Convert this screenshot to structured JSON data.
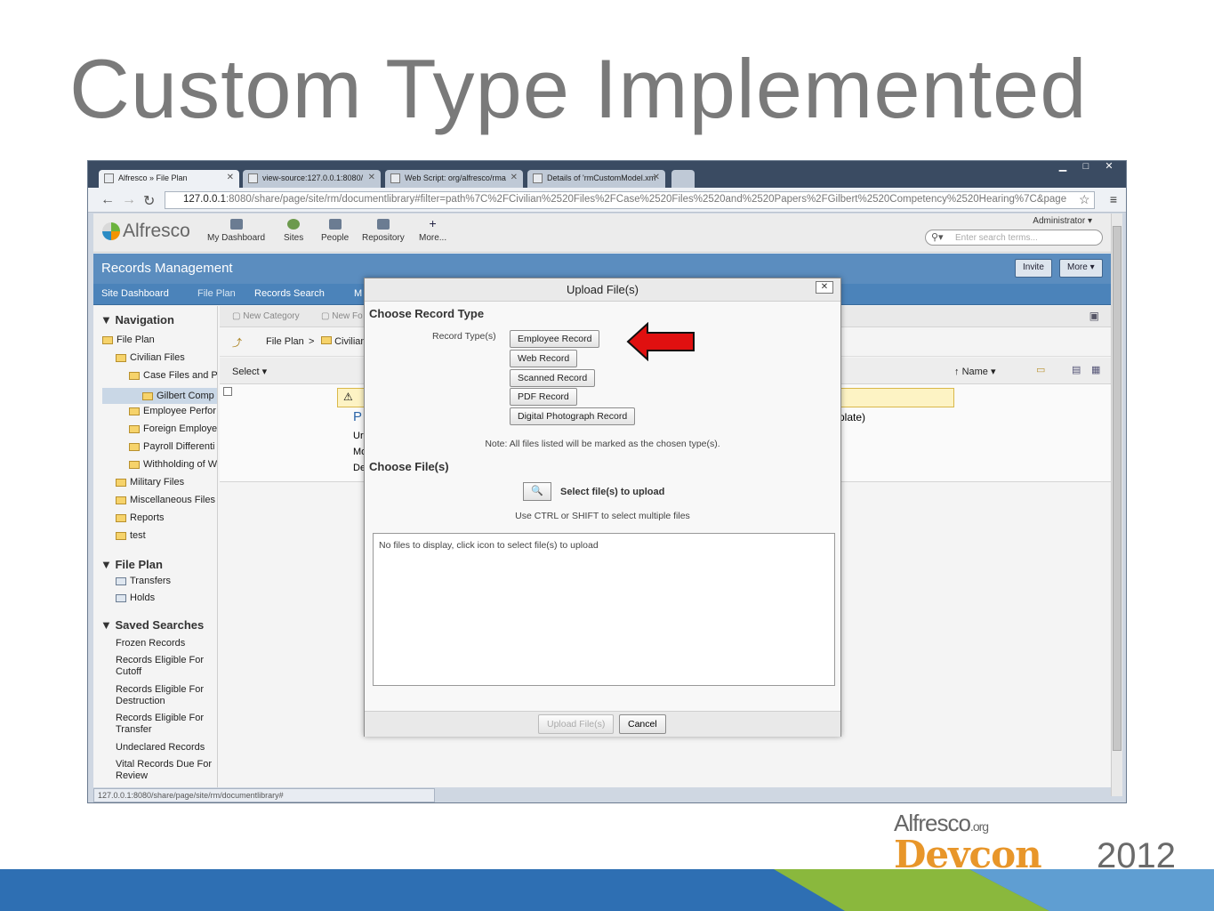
{
  "slide": {
    "title": "Custom Type Implemented",
    "logo_top": "Alfresco",
    "logo_top_suffix": "org",
    "logo_bottom": "Devcon",
    "logo_year": "2012",
    "band_color": "#2e6fb3",
    "band_accent_color": "#8ab83d"
  },
  "browser": {
    "tabs": [
      {
        "label": "Alfresco » File Plan",
        "active": true
      },
      {
        "label": "view-source:127.0.0.1:8080/",
        "active": false
      },
      {
        "label": "Web Script: org/alfresco/rma",
        "active": false
      },
      {
        "label": "Details of 'rmCustomModel.xm",
        "active": false
      }
    ],
    "address_host": "127.0.0.1",
    "address_rest": ":8080/share/page/site/rm/documentlibrary#filter=path%7C%2FCivilian%2520Files%2FCase%2520Files%2520and%2520Papers%2FGilbert%2520Competency%2520Hearing%7C&page",
    "status_url": "127.0.0.1:8080/share/page/site/rm/documentlibrary#"
  },
  "header": {
    "brand": "Alfresco",
    "nav": [
      "My Dashboard",
      "Sites",
      "People",
      "Repository",
      "More..."
    ],
    "user": "Administrator",
    "search_placeholder": "Enter search terms..."
  },
  "rm": {
    "title": "Records Management",
    "invite": "Invite",
    "more": "More",
    "subnav": [
      "Site Dashboard",
      "File Plan",
      "Records Search",
      "M"
    ]
  },
  "sidebar": {
    "navigation_heading": "Navigation",
    "tree": [
      {
        "label": "File Plan",
        "level": 0
      },
      {
        "label": "Civilian Files",
        "level": 1
      },
      {
        "label": "Case Files and P",
        "level": 2
      },
      {
        "label": "Gilbert Comp",
        "level": 3,
        "selected": true
      },
      {
        "label": "Employee Perfor",
        "level": 2
      },
      {
        "label": "Foreign Employe",
        "level": 2
      },
      {
        "label": "Payroll Differenti",
        "level": 2
      },
      {
        "label": "Withholding of W",
        "level": 2
      },
      {
        "label": "Military Files",
        "level": 1
      },
      {
        "label": "Miscellaneous Files",
        "level": 1
      },
      {
        "label": "Reports",
        "level": 1
      },
      {
        "label": "test",
        "level": 1
      }
    ],
    "fileplan_heading": "File Plan",
    "fileplan_items": [
      "Transfers",
      "Holds"
    ],
    "saved_heading": "Saved Searches",
    "saved_items": [
      "Frozen Records",
      "Records Eligible For Cutoff",
      "Records Eligible For Destruction",
      "Records Eligible For Transfer",
      "Undeclared Records",
      "Vital Records Due For Review"
    ]
  },
  "main": {
    "new_category": "New Category",
    "new_folder": "New Fo",
    "crumb_root": "File Plan",
    "crumb_next": "Civilian",
    "select": "Select",
    "sort": "Name",
    "row_letters": [
      "P",
      "Ur",
      "Mo",
      "De"
    ],
    "row_tail": "plate)"
  },
  "dialog": {
    "title": "Upload File(s)",
    "close": "✕",
    "record_heading": "Choose Record Type",
    "record_label": "Record Type(s)",
    "record_types": [
      "Employee Record",
      "Web Record",
      "Scanned Record",
      "PDF Record",
      "Digital Photograph Record"
    ],
    "note": "Note: All files listed will be marked as the chosen type(s).",
    "files_heading": "Choose File(s)",
    "select_files": "Select file(s) to upload",
    "hint": "Use CTRL or SHIFT to select multiple files",
    "empty": "No files to display, click icon to select file(s) to upload",
    "upload_button": "Upload File(s)",
    "cancel_button": "Cancel"
  }
}
